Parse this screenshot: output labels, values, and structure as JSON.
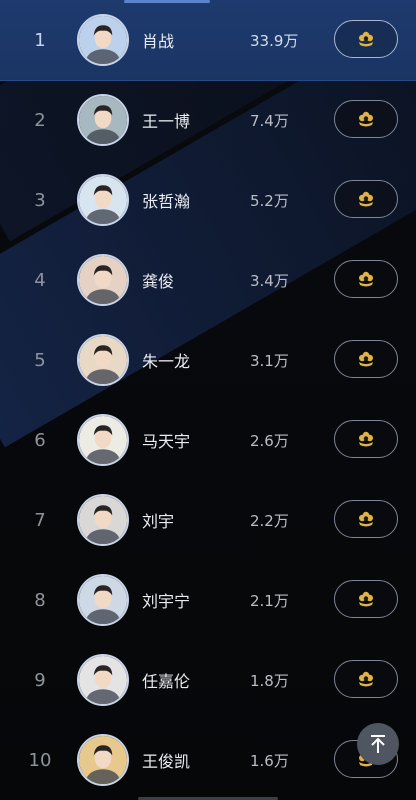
{
  "ranking": [
    {
      "rank": "1",
      "name": "肖战",
      "count": "33.9万",
      "avatar_bg": "#bcd2ec"
    },
    {
      "rank": "2",
      "name": "王一博",
      "count": "7.4万",
      "avatar_bg": "#a8b8c0"
    },
    {
      "rank": "3",
      "name": "张哲瀚",
      "count": "5.2万",
      "avatar_bg": "#d8e4ef"
    },
    {
      "rank": "4",
      "name": "龚俊",
      "count": "3.4万",
      "avatar_bg": "#e6d2c4"
    },
    {
      "rank": "5",
      "name": "朱一龙",
      "count": "3.1万",
      "avatar_bg": "#e8d9c6"
    },
    {
      "rank": "6",
      "name": "马天宇",
      "count": "2.6万",
      "avatar_bg": "#ecebe4"
    },
    {
      "rank": "7",
      "name": "刘宇",
      "count": "2.2万",
      "avatar_bg": "#d9d8d6"
    },
    {
      "rank": "8",
      "name": "刘宇宁",
      "count": "2.1万",
      "avatar_bg": "#cfd9e6"
    },
    {
      "rank": "9",
      "name": "任嘉伦",
      "count": "1.8万",
      "avatar_bg": "#e4e4e4"
    },
    {
      "rank": "10",
      "name": "王俊凯",
      "count": "1.6万",
      "avatar_bg": "#e7c98e"
    }
  ],
  "vote_icon": "flower-badge-icon",
  "back_to_top_icon": "arrow-up-icon",
  "colors": {
    "highlight_row": "#1e3a6e",
    "vote_icon": "#e3b341",
    "avatar_ring": "#c9d4e8"
  }
}
